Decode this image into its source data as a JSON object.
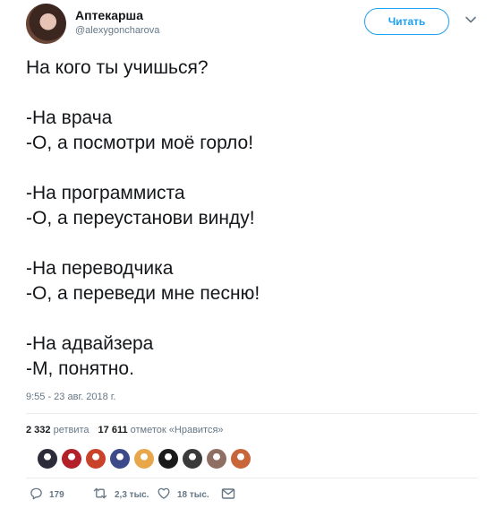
{
  "user": {
    "name": "Аптекарша",
    "handle": "@alexygoncharova",
    "follow_label": "Читать"
  },
  "tweet": {
    "lines": [
      "На кого ты учишься?",
      "",
      "-На врача",
      "-О, а посмотри моё горло!",
      "",
      "-На программиста",
      "-О, а переустанови винду!",
      "",
      "-На переводчика",
      "-О, а переведи мне песню!",
      "",
      "-На адвайзера",
      "-М, понятно."
    ],
    "timestamp": "9:55 - 23 авг. 2018 г."
  },
  "stats": {
    "retweets_count": "2 332",
    "retweets_label": "ретвита",
    "likes_count": "17 611",
    "likes_label": "отметок «Нравится»"
  },
  "likers": {
    "avatar_colors": [
      "#2b2b3a",
      "#b3202a",
      "#c9432b",
      "#3d4a8a",
      "#e8a74a",
      "#1a1a1a",
      "#3a3a3a",
      "#8f6f63",
      "#c7663a"
    ]
  },
  "actions": {
    "replies": "179",
    "retweets": "2,3 тыс.",
    "likes": "18 тыс."
  },
  "colors": {
    "accent": "#1da1f2",
    "secondary_text": "#657786",
    "divider": "#e6ecf0"
  }
}
